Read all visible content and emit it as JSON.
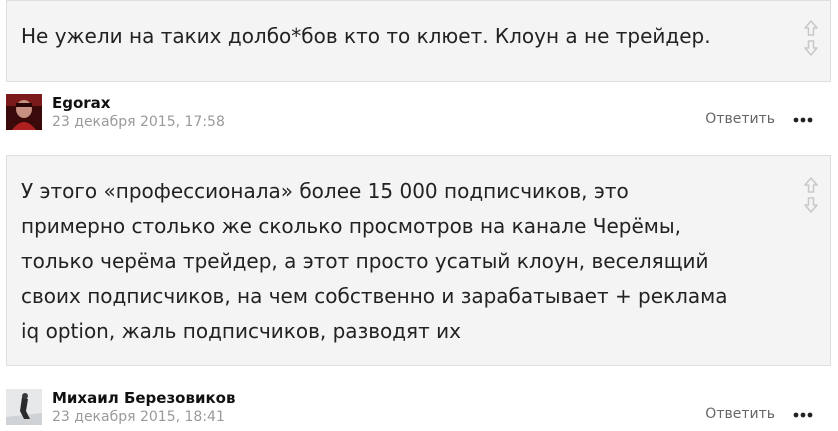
{
  "comments": [
    {
      "text": "Не ужели на таких долбо*бов кто то клюет. Клоун а не трейдер.",
      "author": "Egorax",
      "date": "23 декабря 2015, 17:58",
      "reply_label": "Ответить",
      "avatar_icon": "user-avatar-red-photo"
    },
    {
      "text": "У этого «профессионала» более 15 000 подписчиков, это\nпримерно столько же сколько просмотров на канале Черёмы,\nтолько черёма трейдер, а этот просто усатый клоун, веселящий\nсвоих подписчиков, на чем собственно и зарабатывает + реклама\niq option, жаль подписчиков, разводят их",
      "author": "Михаил Березовиков",
      "date": "23 декабря 2015, 18:41",
      "reply_label": "Ответить",
      "avatar_icon": "user-avatar-snow-photo"
    }
  ],
  "icons": {
    "vote_up": "arrow-up-outline-icon",
    "vote_down": "arrow-down-outline-icon",
    "more": "more-dots-icon"
  },
  "colors": {
    "comment_bg": "#f4f4f4",
    "comment_border": "#dedede",
    "date_text": "#9a9a9a",
    "reply_text": "#666666",
    "icon_gray": "#c8c8c8"
  }
}
